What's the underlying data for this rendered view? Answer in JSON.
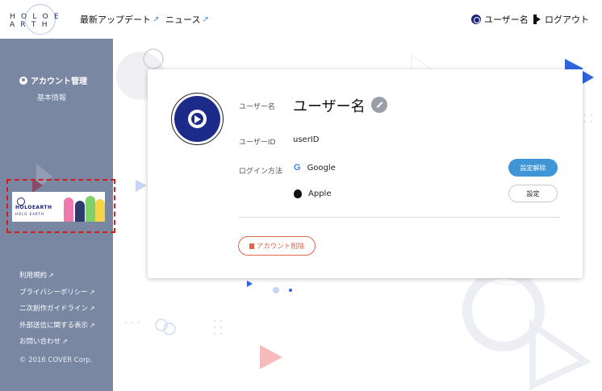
{
  "header": {
    "logo_text": "H O L O E A R T H",
    "nav": [
      {
        "label": "最新アップデート",
        "arrow": "↗"
      },
      {
        "label": "ニュース",
        "arrow": "↗"
      }
    ],
    "user_label": "ユーザー名",
    "logout_label": "ログアウト"
  },
  "sidebar": {
    "account_label": "アカウント管理",
    "basic_info_label": "基本情報",
    "banner": {
      "title": "HOLOEARTH",
      "subtitle": "HOLO EARTH"
    },
    "links": [
      {
        "label": "利用規約",
        "arrow": "↗"
      },
      {
        "label": "プライバシーポリシー",
        "arrow": "↗"
      },
      {
        "label": "二次創作ガイドライン",
        "arrow": "↗"
      },
      {
        "label": "外部送信に関する表示",
        "arrow": "↗"
      },
      {
        "label": "お問い合わせ",
        "arrow": "↗"
      }
    ],
    "copyright": "© 2016 COVER Corp."
  },
  "profile": {
    "username_label": "ユーザー名",
    "username_value": "ユーザー名",
    "userid_label": "ユーザーID",
    "userid_value": "userID",
    "login_method_label": "ログイン方法",
    "providers": [
      {
        "name": "Google",
        "icon": "google-icon",
        "action": "設定解除"
      },
      {
        "name": "Apple",
        "icon": "apple-icon",
        "action": "設定"
      }
    ],
    "delete_label": "アカウント削除"
  },
  "colors": {
    "sidebar_bg": "#7a87a3",
    "accent_blue": "#3f95d6",
    "danger": "#e0644a",
    "brand_navy": "#1c2a8a"
  }
}
